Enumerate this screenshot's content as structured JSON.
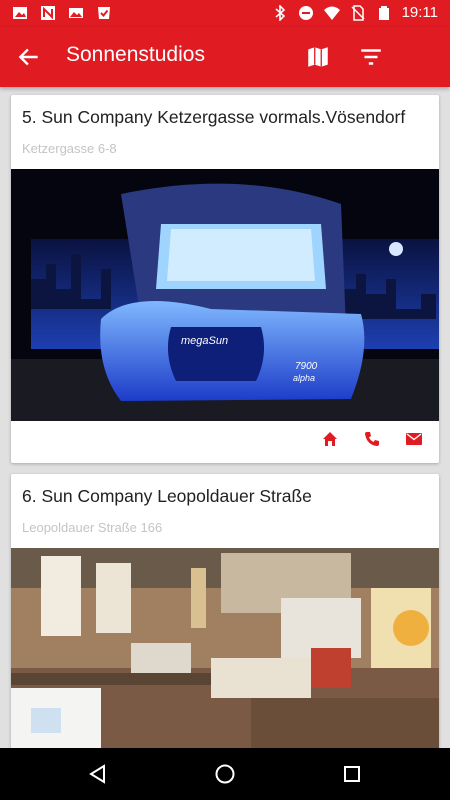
{
  "status_bar": {
    "time": "19:11",
    "left_icons": [
      "image-icon",
      "n-app-icon",
      "photo-icon",
      "download-check-icon"
    ],
    "right_icons": [
      "bluetooth-icon",
      "do-not-disturb-icon",
      "wifi-icon",
      "no-sim-icon",
      "battery-icon"
    ]
  },
  "app_bar": {
    "title": "Sonnenstudios",
    "back_icon": "arrow-back-icon",
    "map_icon": "map-icon",
    "filter_icon": "filter-icon",
    "color": "#e01b22"
  },
  "studios": [
    {
      "name": "5. Sun Company  Ketzergasse  vormals.Vösendorf",
      "address": "Ketzergasse 6-8",
      "image": "megaSun 7900 alpha tanning bed in blue light",
      "photo_texts": [
        "megaSun",
        "7900",
        "alpha"
      ],
      "actions": [
        "home-icon",
        "phone-icon",
        "mail-icon"
      ]
    },
    {
      "name": "6. Sun Company  Leopoldauer Straße",
      "address": "Leopoldauer Straße 166",
      "image": "studio reception counter interior",
      "photo_texts": [],
      "actions": [
        "home-icon",
        "phone-icon",
        "mail-icon"
      ]
    }
  ],
  "nav_bar": {
    "icons": [
      "back-triangle-icon",
      "home-circle-icon",
      "recents-square-icon"
    ]
  }
}
